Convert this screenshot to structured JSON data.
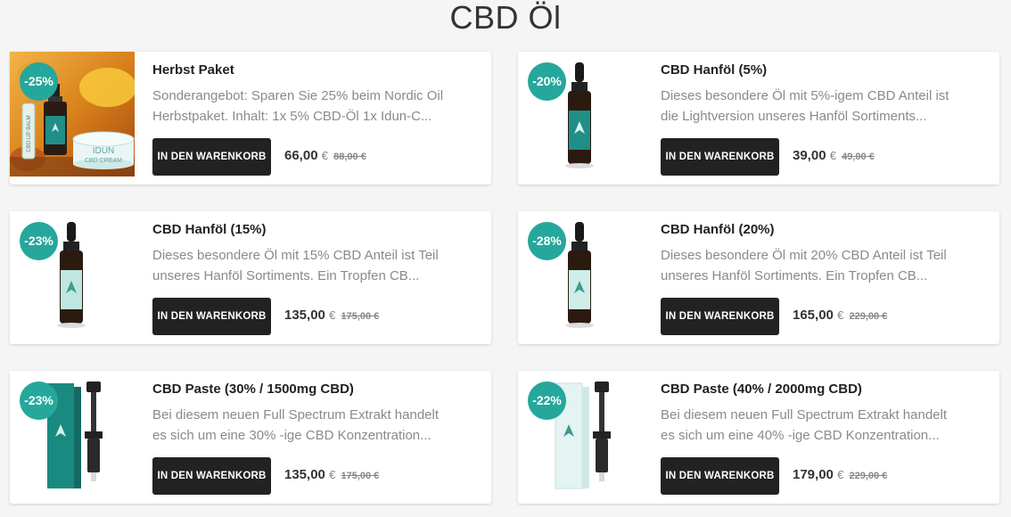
{
  "page": {
    "title": "CBD Öl"
  },
  "products": [
    {
      "name": "Herbst Paket",
      "discount": "-25%",
      "desc_line1": "Sonderangebot: Sparen Sie 25% beim Nordic Oil",
      "desc_line2": "Herbstpaket. Inhalt: 1x 5% CBD-Öl 1x Idun-C...",
      "cart_label": "IN DEN WARENKORB",
      "price": "66,00",
      "currency": "€",
      "old_price": "88,00 €",
      "image": "autumn-bundle",
      "image_labels": {
        "balm": "CBD LIP BALM",
        "cream_brand": "IDUN",
        "cream_name": "CBD CREAM"
      }
    },
    {
      "name": "CBD Hanföl (5%)",
      "discount": "-20%",
      "desc_line1": "Dieses besondere Öl mit 5%-igem CBD Anteil ist",
      "desc_line2": "die Lightversion unseres Hanföl Sortiments...",
      "cart_label": "IN DEN WARENKORB",
      "price": "39,00",
      "currency": "€",
      "old_price": "49,00 €",
      "image": "oil-bottle",
      "label_color": "#1f8f88"
    },
    {
      "name": "CBD Hanföl (15%)",
      "discount": "-23%",
      "desc_line1": "Dieses besondere Öl mit 15% CBD Anteil ist Teil",
      "desc_line2": "unseres Hanföl Sortiments. Ein Tropfen CB...",
      "cart_label": "IN DEN WARENKORB",
      "price": "135,00",
      "currency": "€",
      "old_price": "175,00 €",
      "image": "oil-bottle",
      "label_color": "#bfe6e0"
    },
    {
      "name": "CBD Hanföl (20%)",
      "discount": "-28%",
      "desc_line1": "Dieses besondere Öl mit 20% CBD Anteil ist Teil",
      "desc_line2": "unseres Hanföl Sortiments. Ein Tropfen CB...",
      "cart_label": "IN DEN WARENKORB",
      "price": "165,00",
      "currency": "€",
      "old_price": "229,00 €",
      "image": "oil-bottle",
      "label_color": "#cfeee9"
    },
    {
      "name": "CBD Paste (30% / 1500mg CBD)",
      "discount": "-23%",
      "desc_line1": "Bei diesem neuen Full Spectrum Extrakt handelt",
      "desc_line2": "es sich um eine 30% -ige CBD Konzentration...",
      "cart_label": "IN DEN WARENKORB",
      "price": "135,00",
      "currency": "€",
      "old_price": "175,00 €",
      "image": "paste-syringe",
      "box_color": "#1a8a80"
    },
    {
      "name": "CBD Paste (40% / 2000mg CBD)",
      "discount": "-22%",
      "desc_line1": "Bei diesem neuen Full Spectrum Extrakt handelt",
      "desc_line2": "es sich um eine 40% -ige CBD Konzentration...",
      "cart_label": "IN DEN WARENKORB",
      "price": "179,00",
      "currency": "€",
      "old_price": "229,00 €",
      "image": "paste-syringe",
      "box_color": "#e3f4f2"
    }
  ],
  "colors": {
    "badge": "#26a79b",
    "button": "#222222",
    "background": "#f5f5f5"
  }
}
